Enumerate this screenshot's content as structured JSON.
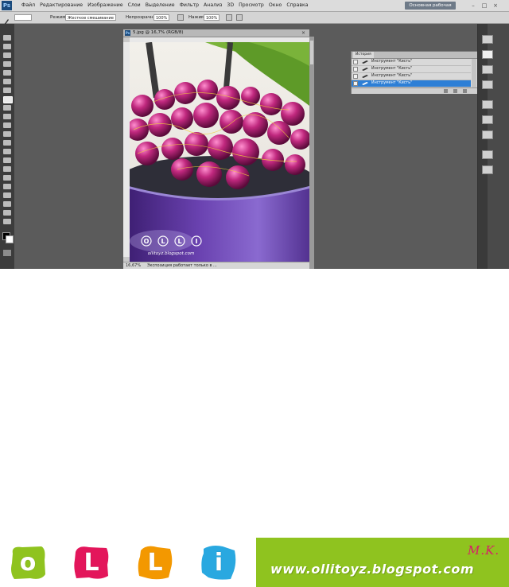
{
  "app": {
    "logo": "Ps",
    "menu": [
      "Файл",
      "Редактирование",
      "Изображение",
      "Слои",
      "Выделение",
      "Фильтр",
      "Анализ",
      "3D",
      "Просмотр",
      "Окно",
      "Справка"
    ],
    "zoom_display": "16,7",
    "workspace_button": "Основная рабочая среда",
    "window_controls": [
      "–",
      "□",
      "×"
    ]
  },
  "options_bar": {
    "mode_label": "Режим:",
    "mode_value": "Жесткое смешивание",
    "opacity_label": "Непрозрачность:",
    "opacity_value": "100%",
    "pressure_label": "Нажим:",
    "pressure_value": "100%"
  },
  "document": {
    "tab_title": "5.jpg @ 16,7% (RGB/8)",
    "status_zoom": "16,67%",
    "status_message": "Экспозиция работает только в ...",
    "watermark_letters": [
      "O",
      "L",
      "L",
      "I"
    ],
    "watermark_url": "ollitoyz.blogspot.com"
  },
  "history_panel": {
    "tab_label": "История",
    "items": [
      {
        "label": "Инструмент \"Кисть\"",
        "selected": false
      },
      {
        "label": "Инструмент \"Кисть\"",
        "selected": false
      },
      {
        "label": "Инструмент \"Кисть\"",
        "selected": false
      },
      {
        "label": "Инструмент \"Кисть\"",
        "selected": true
      }
    ]
  },
  "banner": {
    "letters": [
      {
        "char": "o",
        "color": "#8fc31f"
      },
      {
        "char": "L",
        "color": "#e3165b"
      },
      {
        "char": "L",
        "color": "#f39800"
      },
      {
        "char": "i",
        "color": "#29a8e0"
      }
    ],
    "signature": "M.K.",
    "url": "www.ollitoyz.blogspot.com",
    "green_color": "#8fc31f"
  }
}
